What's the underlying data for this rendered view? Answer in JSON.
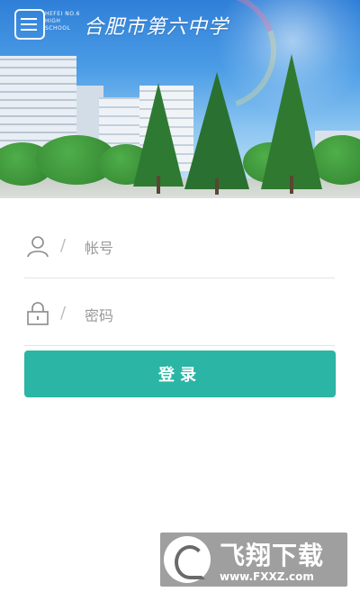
{
  "banner": {
    "school_name": "合肥市第六中学",
    "school_name_en": [
      "HEFEI NO.6",
      "HIGH",
      "SCHOOL"
    ]
  },
  "form": {
    "account": {
      "placeholder": "帐号",
      "value": ""
    },
    "password": {
      "placeholder": "密码",
      "value": ""
    },
    "separator": "/",
    "login_label": "登录"
  },
  "watermark": {
    "brand": "飞翔下载",
    "url": "www.FXXZ.com"
  },
  "colors": {
    "accent": "#2bb5a4",
    "divider": "#e3e3e3",
    "placeholder": "#9a9a9a"
  },
  "icons": {
    "account": "user-icon",
    "password": "lock-icon",
    "logo": "school-logo-icon"
  }
}
